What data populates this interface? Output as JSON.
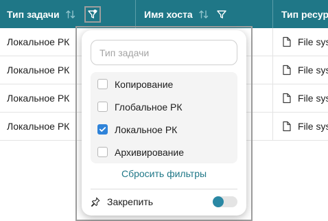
{
  "table": {
    "columns": [
      {
        "label": "Тип задачи",
        "sort_icon": "sort-arrows-icon",
        "filter_icon": "filter-icon",
        "filter_active": true
      },
      {
        "label": "Имя хоста",
        "sort_icon": "sort-arrows-icon",
        "filter_icon": "filter-icon",
        "filter_active": false
      },
      {
        "label": "Тип ресурс"
      }
    ],
    "rows": [
      {
        "task_type": "Локальное РК",
        "host": "",
        "resource": "File sys"
      },
      {
        "task_type": "Локальное РК",
        "host": "",
        "resource": "File sys"
      },
      {
        "task_type": "Локальное РК",
        "host": "",
        "resource": "File sys"
      },
      {
        "task_type": "Локальное РК",
        "host": "",
        "resource": "File sys"
      }
    ],
    "resource_icon": "file-icon"
  },
  "filter_popup": {
    "search_placeholder": "Тип задачи",
    "search_value": "",
    "options": [
      {
        "label": "Копирование",
        "checked": false
      },
      {
        "label": "Глобальное РК",
        "checked": false
      },
      {
        "label": "Локальное РК",
        "checked": true
      },
      {
        "label": "Архивирование",
        "checked": false
      }
    ],
    "reset_label": "Сбросить фильтры",
    "pin_label": "Закрепить",
    "pin_icon": "pin-icon",
    "pin_enabled": false
  },
  "colors": {
    "header_bg": "#1f7787",
    "accent": "#1f7787",
    "checkbox_checked": "#2f83d9",
    "toggle_knob": "#2a88a4"
  }
}
